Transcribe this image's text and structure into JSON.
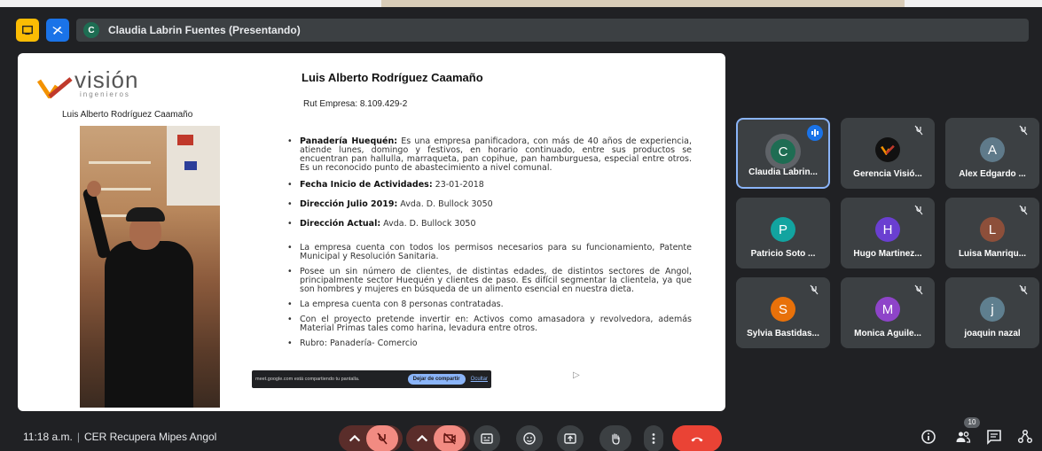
{
  "meeting": {
    "presenter_initial": "C",
    "presenter_label": "Claudia Labrin Fuentes (Presentando)",
    "time": "11:18 a.m.",
    "separator": "|",
    "meeting_name": "CER Recupera Mipes Angol",
    "participant_count": "10"
  },
  "slide": {
    "logo_word": "visión",
    "logo_sub": "ingenieros",
    "photo_caption": "Luis Alberto Rodríguez Caamaño",
    "title": "Luis Alberto Rodríguez Caamaño",
    "rut": "Rut Empresa: 8.109.429-2",
    "bullets": [
      {
        "label": "Panadería Huequén:",
        "text": " Es una empresa panificadora, con más de 40 años de experiencia, atiende lunes, domingo y festivos, en horario continuado, entre sus productos se encuentran pan hallulla, marraqueta, pan copihue, pan hamburguesa, especial entre otros. Es un reconocido punto de abastecimiento a nivel comunal."
      },
      {
        "label": "Fecha Inicio de Actividades:",
        "text": " 23-01-2018"
      },
      {
        "label": "Dirección Julio 2019:",
        "text": " Avda. D. Bullock 3050"
      },
      {
        "label": "Dirección Actual:",
        "text": " Avda. D. Bullock 3050"
      },
      {
        "label": "",
        "text": "La empresa cuenta con todos los permisos necesarios para su funcionamiento, Patente Municipal y Resolución Sanitaria."
      },
      {
        "label": "",
        "text": "Posee un sin número de clientes, de distintas edades, de distintos sectores de Angol, principalmente sector Huequén y clientes de paso. Es difícil segmentar la clientela, ya que son hombres y mujeres en búsqueda de un alimento esencial en nuestra dieta."
      },
      {
        "label": "",
        "text": "La empresa cuenta con 8  personas contratadas."
      },
      {
        "label": "",
        "text": "Con el proyecto pretende invertir en: Activos como amasadora y revolvedora, además Material Primas tales como harina, levadura entre otros."
      },
      {
        "label": "",
        "text": "Rubro: Panadería- Comercio"
      }
    ],
    "share_bar_text": "meet.google.com está compartiendo tu pantalla.",
    "stop_share_label": "Dejar de compartir",
    "hide_label": "Ocultar"
  },
  "participants": [
    {
      "initial": "C",
      "name": "Claudia Labrin...",
      "color": "#1e6d53",
      "speaking": true
    },
    {
      "initial": "",
      "name": "Gerencia Visió...",
      "color": "#111111",
      "logo": true
    },
    {
      "initial": "A",
      "name": "Alex Edgardo ...",
      "color": "#5f7a8a"
    },
    {
      "initial": "P",
      "name": "Patricio Soto ...",
      "color": "#12a4a0"
    },
    {
      "initial": "H",
      "name": "Hugo Martinez...",
      "color": "#6a3fd1"
    },
    {
      "initial": "L",
      "name": "Luisa Manriqu...",
      "color": "#8d4f3a"
    },
    {
      "initial": "S",
      "name": "Sylvia Bastidas...",
      "color": "#e8710a"
    },
    {
      "initial": "M",
      "name": "Monica Aguile...",
      "color": "#8e44c9"
    },
    {
      "initial": "j",
      "name": "joaquin nazal",
      "color": "#5f7f8f"
    }
  ],
  "colors": {
    "end_call": "#ea4335",
    "muted": "#f28b82",
    "control_bg": "#3c4043",
    "accent": "#8ab4f8"
  }
}
